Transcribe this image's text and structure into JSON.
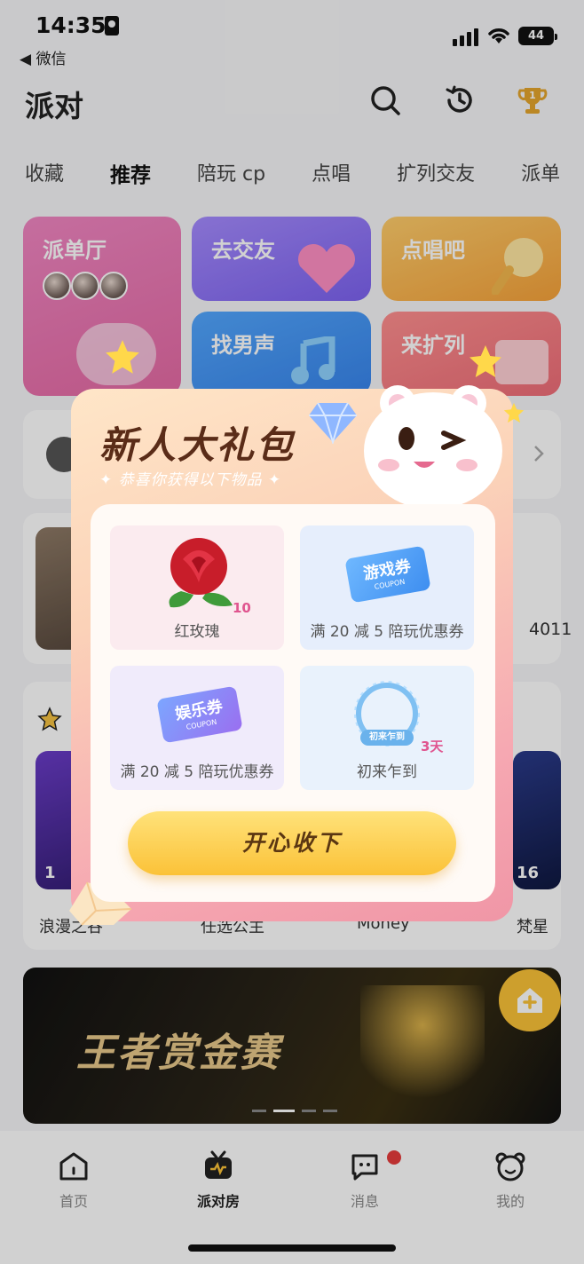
{
  "status": {
    "time": "14:35",
    "back_label": "◀ 微信",
    "battery": "44"
  },
  "header": {
    "title": "派对"
  },
  "tabs": [
    "收藏",
    "推荐",
    "陪玩 cp",
    "点唱",
    "扩列交友",
    "派单"
  ],
  "cards": {
    "paidanting": "派单厅",
    "qujiaoyou": "去交友",
    "dianchangba": "点唱吧",
    "zhaonansheng": "找男声",
    "laikuolie": "来扩列"
  },
  "rooms": {
    "number_fragment": "4011",
    "live_counts": [
      "1",
      "16"
    ],
    "room_names": [
      "浪漫之谷",
      "任选公主",
      "Money",
      "梵星"
    ]
  },
  "banner": {
    "title": "王者赏金赛"
  },
  "nav": [
    {
      "label": "首页"
    },
    {
      "label": "派对房"
    },
    {
      "label": "消息"
    },
    {
      "label": "我的"
    }
  ],
  "modal": {
    "title": "新人大礼包",
    "subtitle": "✦ 恭喜你获得以下物品 ✦",
    "items": [
      {
        "label": "红玫瑰",
        "badge": "10"
      },
      {
        "label": "满 20 减 5 陪玩优惠券",
        "ticket": "游戏券",
        "ticket_sub": "COUPON"
      },
      {
        "label": "满 20 减 5 陪玩优惠券",
        "ticket": "娱乐券",
        "ticket_sub": "COUPON"
      },
      {
        "label": "初来乍到",
        "badge": "3天",
        "frame_text": "初来乍到"
      }
    ],
    "accept_label": "开心收下"
  },
  "colors": {
    "accent": "#fbc238",
    "pink": "#f096a6",
    "purple": "#8a6ef0"
  }
}
